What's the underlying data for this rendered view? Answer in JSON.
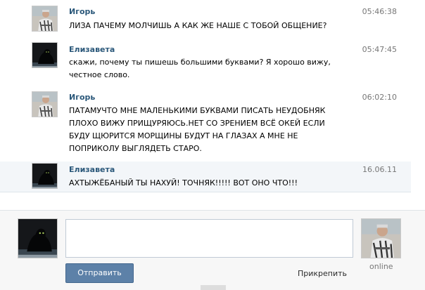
{
  "messages": [
    {
      "author": "Игорь",
      "time": "05:46:38",
      "lines": [
        "ЛИЗА ПАЧЕМУ МОЛЧИШЬ А КАК ЖЕ НАШЕ С ТОБОЙ ОБЩЕНИЕ?"
      ]
    },
    {
      "author": "Елизавета",
      "time": "05:47:45",
      "lines": [
        "скажи, почему ты пишешь большими буквами? Я хорошо вижу,",
        "честное слово."
      ]
    },
    {
      "author": "Игорь",
      "time": "06:02:10",
      "lines": [
        "ПАТАМУЧТО МНЕ МАЛЕНЬКИМИ БУКВАМИ ПИСАТЬ НЕУДОБНЯК",
        "ПЛОХО ВИЖУ ПРИЩУРЯЮСЬ.НЕТ СО ЗРЕНИЕМ ВСЁ ОКЕЙ ЕСЛИ",
        "БУДУ ЩЮРИТСЯ МОРЩИНЫ БУДУТ НА ГЛАЗАХ А МНЕ НЕ",
        "ПОПРИКОЛУ ВЫГЛЯДЕТЬ СТАРО."
      ]
    },
    {
      "author": "Елизавета",
      "time": "16.06.11",
      "lines": [
        "АХТЫЖЁБАНЫЙ ТЫ НАХУЙ! ТОЧНЯК!!!!! ВОТ ОНО ЧТО!!!"
      ]
    }
  ],
  "compose": {
    "send_label": "Отправить",
    "attach_label": "Прикрепить",
    "status_label": "online",
    "message_value": ""
  },
  "avatars": {
    "igor": "avatar-photo-man",
    "elizaveta": "avatar-photo-panther"
  },
  "colors": {
    "author": "#2b587a",
    "button": "#5d81a8",
    "highlight_row": "#f3f6f9"
  }
}
